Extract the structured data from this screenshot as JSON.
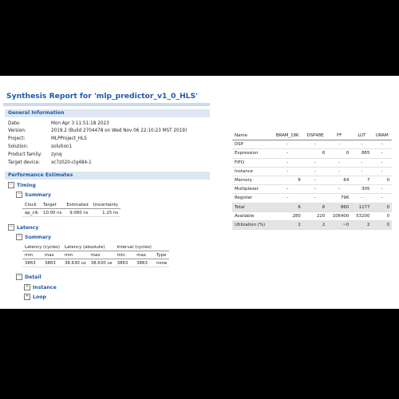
{
  "report": {
    "title": "Synthesis Report for 'mlp_predictor_v1_0_HLS'",
    "general_header": "General Information",
    "info": [
      {
        "k": "Date:",
        "v": "Mon Apr 3 11:51:18 2023"
      },
      {
        "k": "Version:",
        "v": "2019.2 (Build 2704478 on Wed Nov 06 22:10:23 MST 2019)"
      },
      {
        "k": "Project:",
        "v": "MLPProject_HLS"
      },
      {
        "k": "Solution:",
        "v": "solution1"
      },
      {
        "k": "Product family:",
        "v": "zynq"
      },
      {
        "k": "Target device:",
        "v": "xc7z020-clg484-1"
      }
    ],
    "perf_header": "Performance Estimates",
    "timing": {
      "label": "Timing",
      "summary_label": "Summary",
      "columns": [
        "Clock",
        "Target",
        "Estimated",
        "Uncertainty"
      ],
      "rows": [
        [
          "ap_clk",
          "10.00 ns",
          "9.060 ns",
          "1.25 ns"
        ]
      ]
    },
    "latency": {
      "label": "Latency",
      "summary_label": "Summary",
      "group_headers": [
        "Latency (cycles)",
        "Latency (absolute)",
        "Interval (cycles)",
        ""
      ],
      "columns": [
        "min",
        "max",
        "min",
        "max",
        "min",
        "max",
        "Type"
      ],
      "rows": [
        [
          "3863",
          "3863",
          "38.630 us",
          "38.630 us",
          "3863",
          "3863",
          "none"
        ]
      ],
      "detail_label": "Detail",
      "instance_label": "Instance",
      "loop_label": "Loop"
    },
    "toggle_minus": "−",
    "toggle_plus": "+"
  },
  "utilization": {
    "columns": [
      "Name",
      "BRAM_18K",
      "DSP48E",
      "FF",
      "LUT",
      "URAM"
    ],
    "rows": [
      [
        "DSP",
        "-",
        "-",
        "-",
        "-",
        "-"
      ],
      [
        "Expression",
        "-",
        "6",
        "0",
        "865",
        "-"
      ],
      [
        "FIFO",
        "-",
        "-",
        "-",
        "-",
        "-"
      ],
      [
        "Instance",
        "-",
        "-",
        "-",
        "-",
        "-"
      ],
      [
        "Memory",
        "6",
        "-",
        "64",
        "7",
        "0"
      ],
      [
        "Multiplexer",
        "-",
        "-",
        "-",
        "305",
        "-"
      ],
      [
        "Register",
        "-",
        "-",
        "796",
        "-",
        "-"
      ]
    ],
    "total": [
      "Total",
      "6",
      "6",
      "860",
      "1177",
      "0"
    ],
    "available": [
      "Available",
      "280",
      "220",
      "106400",
      "53200",
      "0"
    ],
    "utilization": [
      "Utilization (%)",
      "2",
      "2",
      "~0",
      "2",
      "0"
    ]
  }
}
